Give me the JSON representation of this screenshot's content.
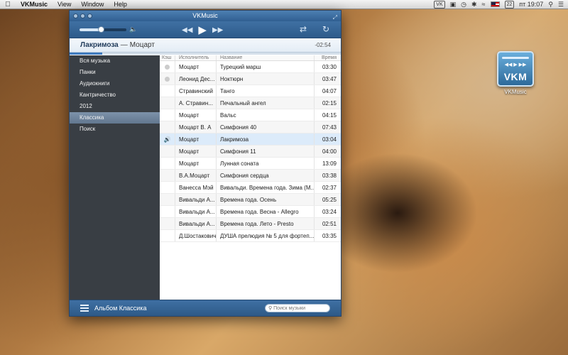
{
  "menubar": {
    "app_name": "VKMusic",
    "menus": [
      "View",
      "Window",
      "Help"
    ],
    "badge": "22",
    "clock": "пт 19:07"
  },
  "desktop": {
    "icon_label": "VKMusic",
    "icon_text": "VKM"
  },
  "window": {
    "title": "VKMusic",
    "volume_level": 0.45,
    "now_playing": {
      "title": "Лакримоза",
      "separator": "—",
      "artist": "Моцарт",
      "remaining": "-02:54",
      "progress": 0.12
    },
    "sidebar": [
      {
        "label": "Вся музыка",
        "active": false
      },
      {
        "label": "Панки",
        "active": false
      },
      {
        "label": "Аудиокниги",
        "active": false
      },
      {
        "label": "Кантричество",
        "active": false
      },
      {
        "label": "2012",
        "active": false
      },
      {
        "label": "Классика",
        "active": true
      },
      {
        "label": "Поиск",
        "active": false
      }
    ],
    "columns": {
      "cache": "Кэш",
      "artist": "Исполнитель",
      "title": "Название",
      "time": "Время"
    },
    "tracks": [
      {
        "cached": true,
        "artist": "Моцарт",
        "title": "Турецкий марш",
        "time": "03:30"
      },
      {
        "cached": true,
        "artist": "Леонид Дес...",
        "title": "Ноктюрн",
        "time": "03:47"
      },
      {
        "cached": false,
        "artist": "Стравинский",
        "title": "Танго",
        "time": "04:07"
      },
      {
        "cached": false,
        "artist": "А. Стравин...",
        "title": "Печальный ангел",
        "time": "02:15"
      },
      {
        "cached": false,
        "artist": "Моцарт",
        "title": "Вальс",
        "time": "04:15"
      },
      {
        "cached": false,
        "artist": "Моцарт В. А",
        "title": "Симфония  40",
        "time": "07:43"
      },
      {
        "cached": false,
        "artist": "Моцарт",
        "title": "Лакримоза",
        "time": "03:04",
        "current": true
      },
      {
        "cached": false,
        "artist": "Моцарт",
        "title": "Симфония 11",
        "time": "04:00"
      },
      {
        "cached": false,
        "artist": "Моцарт",
        "title": "Лунная соната",
        "time": "13:09"
      },
      {
        "cached": false,
        "artist": "В.А.Моцарт",
        "title": "Симфония сердца",
        "time": "03:38"
      },
      {
        "cached": false,
        "artist": "Ванесса Мэй",
        "title": "Вивальди. Времена года. Зима (М...",
        "time": "02:37"
      },
      {
        "cached": false,
        "artist": "Вивальди А...",
        "title": "Времена года. Осень",
        "time": "05:25"
      },
      {
        "cached": false,
        "artist": "Вивальди А...",
        "title": "Времена года. Весна - Allegro",
        "time": "03:24"
      },
      {
        "cached": false,
        "artist": "Вивальди А...",
        "title": "Времена года. Лето - Presto",
        "time": "02:51"
      },
      {
        "cached": false,
        "artist": "Д.Шостакович",
        "title": "ДУША прелюдия № 5 для фортеп...",
        "time": "03:35"
      }
    ],
    "bottom": {
      "album_label": "Альбом Классика",
      "search_placeholder": "Поиск музыки"
    }
  },
  "colors": {
    "accent": "#3f70a3",
    "sidebar_bg": "#393e44",
    "active_row": "#dcebfa"
  }
}
